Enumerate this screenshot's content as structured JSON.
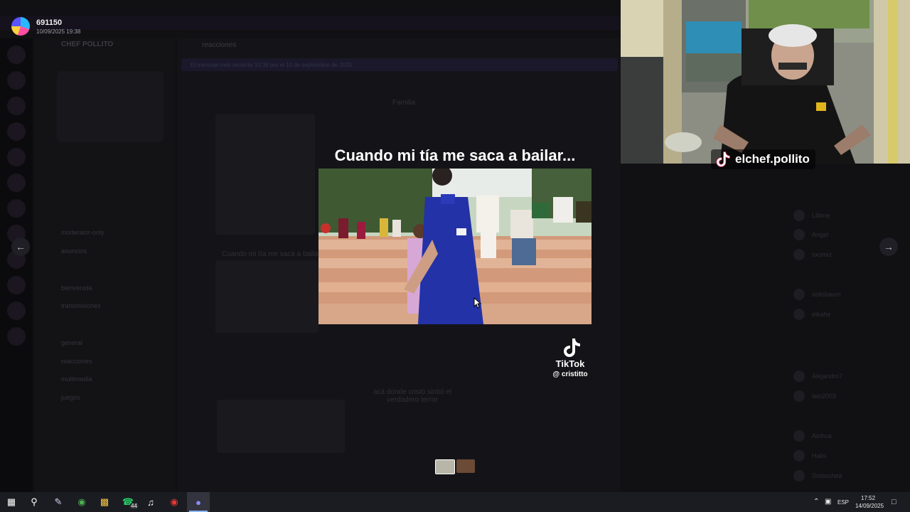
{
  "post": {
    "author": "691150",
    "timestamp": "10/09/2025 19:38"
  },
  "background": {
    "server_name": "CHEF POLLITO",
    "channel_title": "reacciones",
    "notice": "El mensaje más reciente 10:38 por el 10 de septiembre de 2025",
    "embed_label": "Familia",
    "ghost_caption": "Cuando mi tía me saca a bailar...",
    "ghost_message": "acá donde cristo sintió el verdadero terror",
    "channels": [
      "moderator-only",
      "anuncios",
      "bienvenida",
      "transmisiones",
      "general",
      "reacciones",
      "multimedia",
      "juegos"
    ],
    "members": [
      "Lillime",
      "Angel",
      "sxomiz",
      "xolisbaum",
      "elkahe",
      "Alejandro7",
      "lalo2003",
      "Ainhoa",
      "Halis",
      "Sotasshea"
    ]
  },
  "video": {
    "caption": "Cuando mi tía me saca a bailar...",
    "platform": "TikTok",
    "handle": "@ cristitto"
  },
  "webcam": {
    "handle": "elchef.pollito"
  },
  "taskbar": {
    "whatsapp_badge": "44",
    "language": "ESP",
    "time": "17:52",
    "date": "14/09/2025"
  },
  "icons": {
    "prev": "arrow-left-icon",
    "next": "arrow-right-icon",
    "tiktok": "tiktok-icon"
  }
}
